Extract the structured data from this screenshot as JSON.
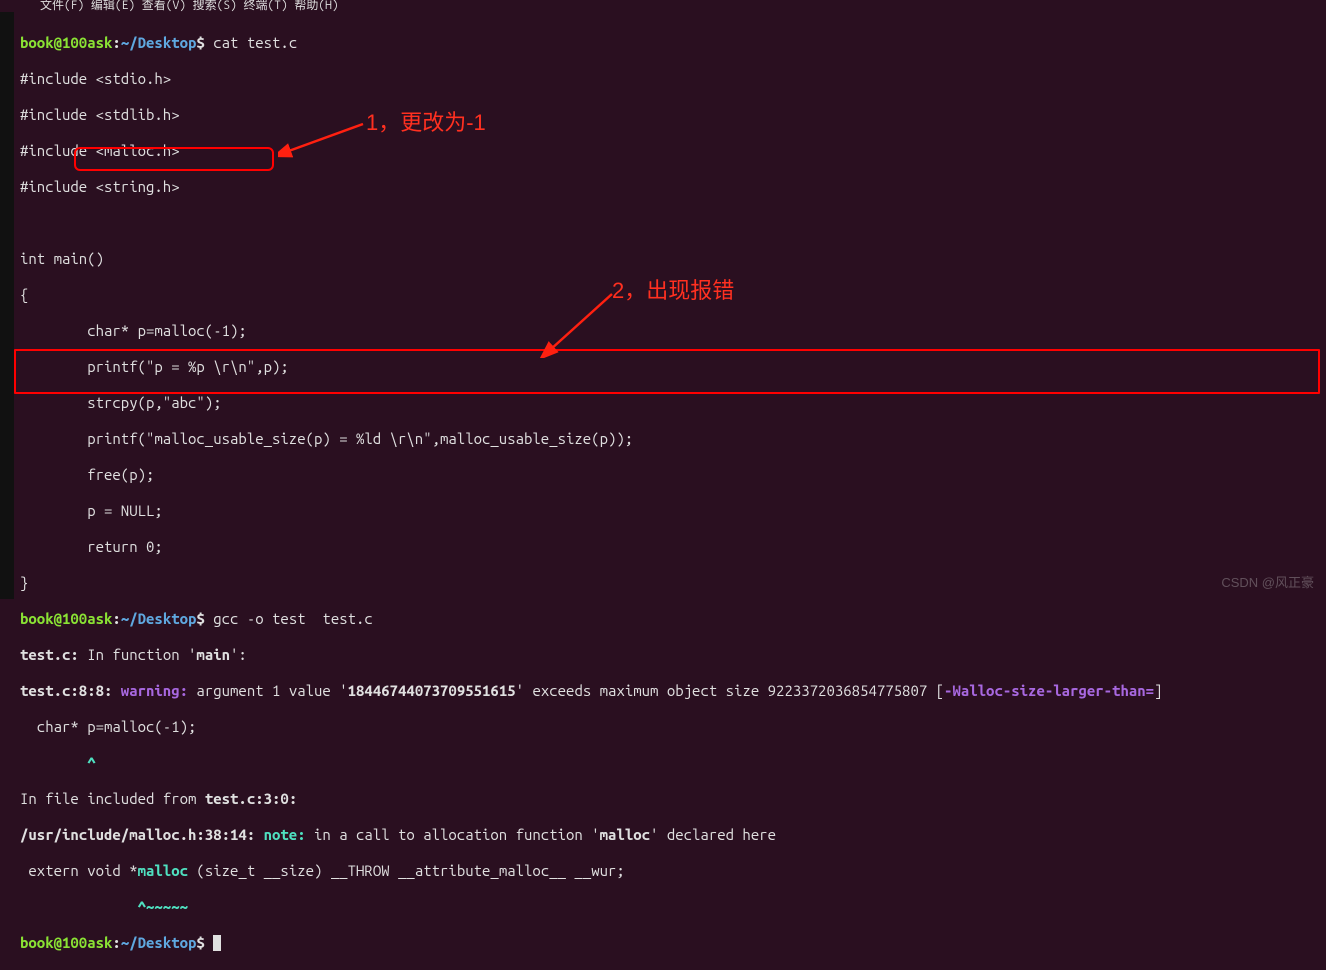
{
  "menubar": "文件(F)  编辑(E)  查看(V)  搜索(S)  终端(T)  帮助(H)",
  "prompt": {
    "user": "book@100ask",
    "colon": ":",
    "path": "~/Desktop",
    "sign": "$"
  },
  "commands": {
    "cat": " cat test.c",
    "gcc": " gcc -o test  test.c",
    "empty": " "
  },
  "source": {
    "l1": "#include <stdio.h>",
    "l2": "#include <stdlib.h>",
    "l3": "#include <malloc.h>",
    "l4": "#include <string.h>",
    "l5": "",
    "l6": "int main()",
    "l7": "{",
    "l8": "        char* p=malloc(-1);",
    "l9": "        printf(\"p = %p \\r\\n\",p);",
    "l10": "        strcpy(p,\"abc\");",
    "l11": "        printf(\"malloc_usable_size(p) = %ld \\r\\n\",malloc_usable_size(p));",
    "l12": "        free(p);",
    "l13": "        p = NULL;",
    "l14": "        return 0;",
    "l15": "}"
  },
  "compiler": {
    "in_function_pre": "test.c:",
    "in_function_text": " In function '",
    "in_function_name": "main",
    "in_function_post": "':",
    "warn_loc": "test.c:8:8:",
    "warn_tag": " warning:",
    "warn_msg_pre": " argument 1 value '",
    "warn_value": "18446744073709551615",
    "warn_msg_mid": "' exceeds maximum object size 9223372036854775807 [",
    "warn_opt": "-Walloc-size-larger-than=",
    "warn_msg_post": "]",
    "warn_code": "  char* p=malloc(-1);",
    "warn_caret": "        ^",
    "incl_pre": "In file included from ",
    "incl_file": "test.c:3:0:",
    "note_loc": "/usr/include/malloc.h:38:14:",
    "note_tag": " note:",
    "note_msg_pre": " in a call to allocation function '",
    "note_func": "malloc",
    "note_msg_post": "' declared here",
    "note_code_pre": " extern void *",
    "note_code_func": "malloc",
    "note_code_post": " (size_t __size) __THROW __attribute_malloc__ __wur;",
    "note_caret": "              ^~~~~~"
  },
  "annotations": {
    "a1": "1，更改为-1",
    "a2": "2，出现报错"
  },
  "watermark": "CSDN @风正豪"
}
